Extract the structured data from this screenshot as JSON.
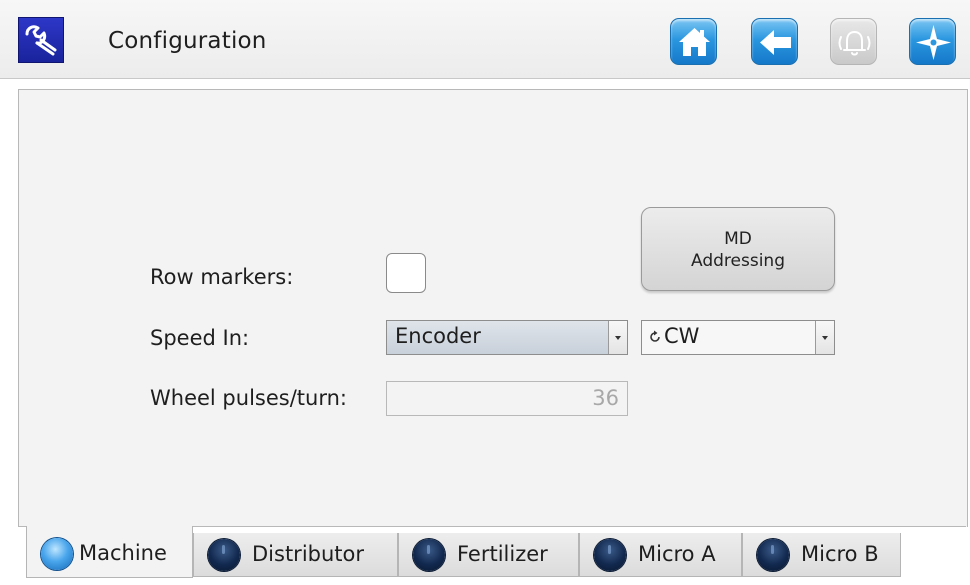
{
  "header": {
    "title": "Configuration",
    "icons": [
      "wrench-icon",
      "home-icon",
      "back-arrow-icon",
      "alarm-bell-icon",
      "compass-icon"
    ],
    "accent_color": "#2b97e0",
    "app_icon_color": "#1f2ab6"
  },
  "form": {
    "row_markers_label": "Row markers:",
    "row_markers_checked": false,
    "speed_in_label": "Speed In:",
    "speed_in_value": "Encoder",
    "direction_value": "CW",
    "wheel_pulses_label": "Wheel pulses/turn:",
    "wheel_pulses_value": "36",
    "md_button_line1": "MD",
    "md_button_line2": "Addressing"
  },
  "tabs": [
    {
      "label": "Machine",
      "active": true
    },
    {
      "label": "Distributor",
      "active": false
    },
    {
      "label": "Fertilizer",
      "active": false
    },
    {
      "label": "Micro A",
      "active": false
    },
    {
      "label": "Micro B",
      "active": false
    }
  ]
}
